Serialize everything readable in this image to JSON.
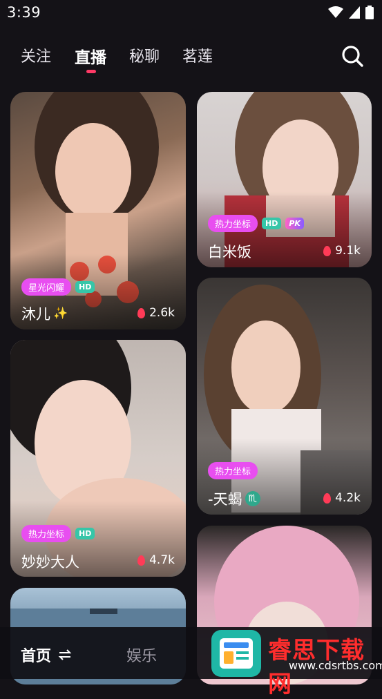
{
  "status": {
    "time": "3:39"
  },
  "tabs": [
    {
      "label": "关注"
    },
    {
      "label": "直播"
    },
    {
      "label": "秘聊"
    },
    {
      "label": "茗莲"
    }
  ],
  "cards": [
    {
      "name": "沐儿",
      "name_suffix": "✨",
      "heat": "2.6k",
      "badge": "星光闪耀",
      "hd": "HD"
    },
    {
      "name": "白米饭",
      "heat": "9.1k",
      "badge": "热力坐标",
      "hd": "HD",
      "pk": "PK"
    },
    {
      "name": "妙妙大人",
      "heat": "4.7k",
      "badge": "热力坐标",
      "hd": "HD"
    },
    {
      "name": "-天蝎",
      "zodiac": "♏",
      "heat": "4.2k",
      "badge": "热力坐标"
    }
  ],
  "bottom_nav": {
    "home": "首页",
    "entertainment": "娱乐"
  },
  "watermark": {
    "text": "睿思下载网",
    "domain": "www.cdsrtbs.com"
  },
  "colors": {
    "accent": "#ff3a66",
    "badge_pink": "#e84ef0",
    "badge_hd": "#36c6a8"
  }
}
